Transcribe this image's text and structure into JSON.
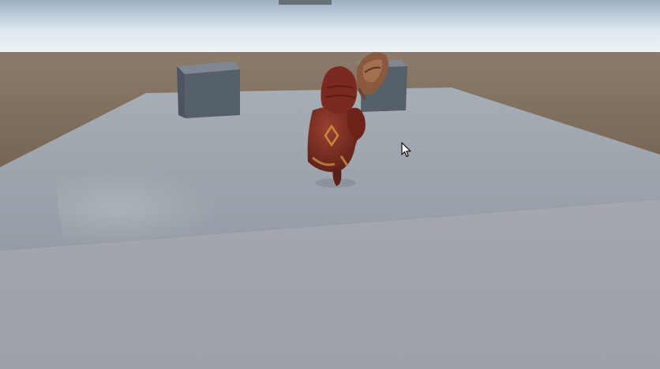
{
  "scene": {
    "sky_top_color": "#9fb4c6",
    "sky_horizon_color": "#eef3f7",
    "ground_color": "#6e5c4b",
    "platform_top_color": "#9ba2ab",
    "platform_front_color": "#a2a7ae",
    "cube_color": "#5c666f",
    "character_robe_color": "#7a2f22",
    "cursor_icon": "arrow-cursor-icon"
  }
}
